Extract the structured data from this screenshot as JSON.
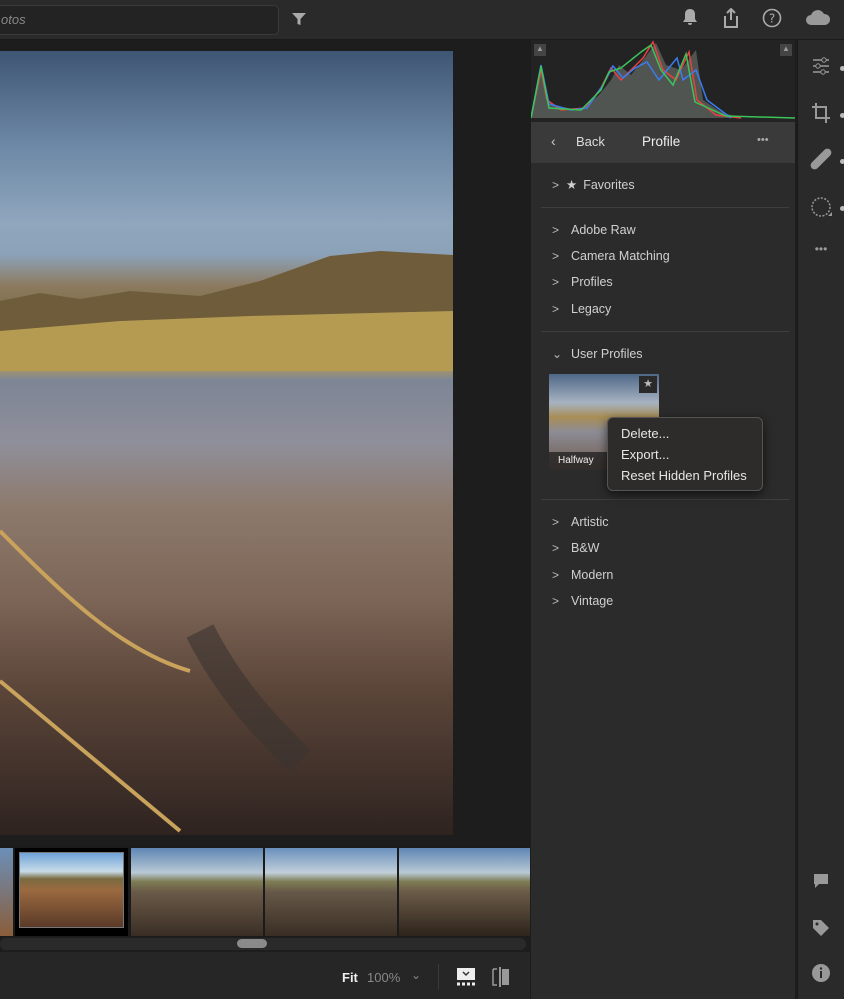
{
  "topbar": {
    "search_text": "otos",
    "icons": [
      "filter-icon",
      "bell-icon",
      "share-icon",
      "help-icon",
      "cloud-icon"
    ]
  },
  "panel": {
    "header": {
      "back_label": "Back",
      "title": "Profile",
      "more_label": "•••"
    },
    "favorites_label": "Favorites",
    "groups1": [
      "Adobe Raw",
      "Camera Matching",
      "Profiles",
      "Legacy"
    ],
    "user_profiles_label": "User Profiles",
    "profile_thumb_label": "Halfway",
    "groups2": [
      "Artistic",
      "B&W",
      "Modern",
      "Vintage"
    ]
  },
  "context_menu": {
    "items": [
      "Delete...",
      "Export...",
      "Reset Hidden Profiles"
    ]
  },
  "bottombar": {
    "fit_label": "Fit",
    "zoom_value": "100%"
  },
  "toolstrip": {
    "icons": [
      "edit-sliders-icon",
      "crop-icon",
      "healing-icon",
      "masking-icon",
      "more-icon",
      "comment-icon",
      "tag-icon",
      "info-icon"
    ]
  },
  "colors": {
    "panel_bg": "#2b2b2b",
    "header_bg": "#3a3a3a",
    "app_bg": "#1d1d1d"
  }
}
